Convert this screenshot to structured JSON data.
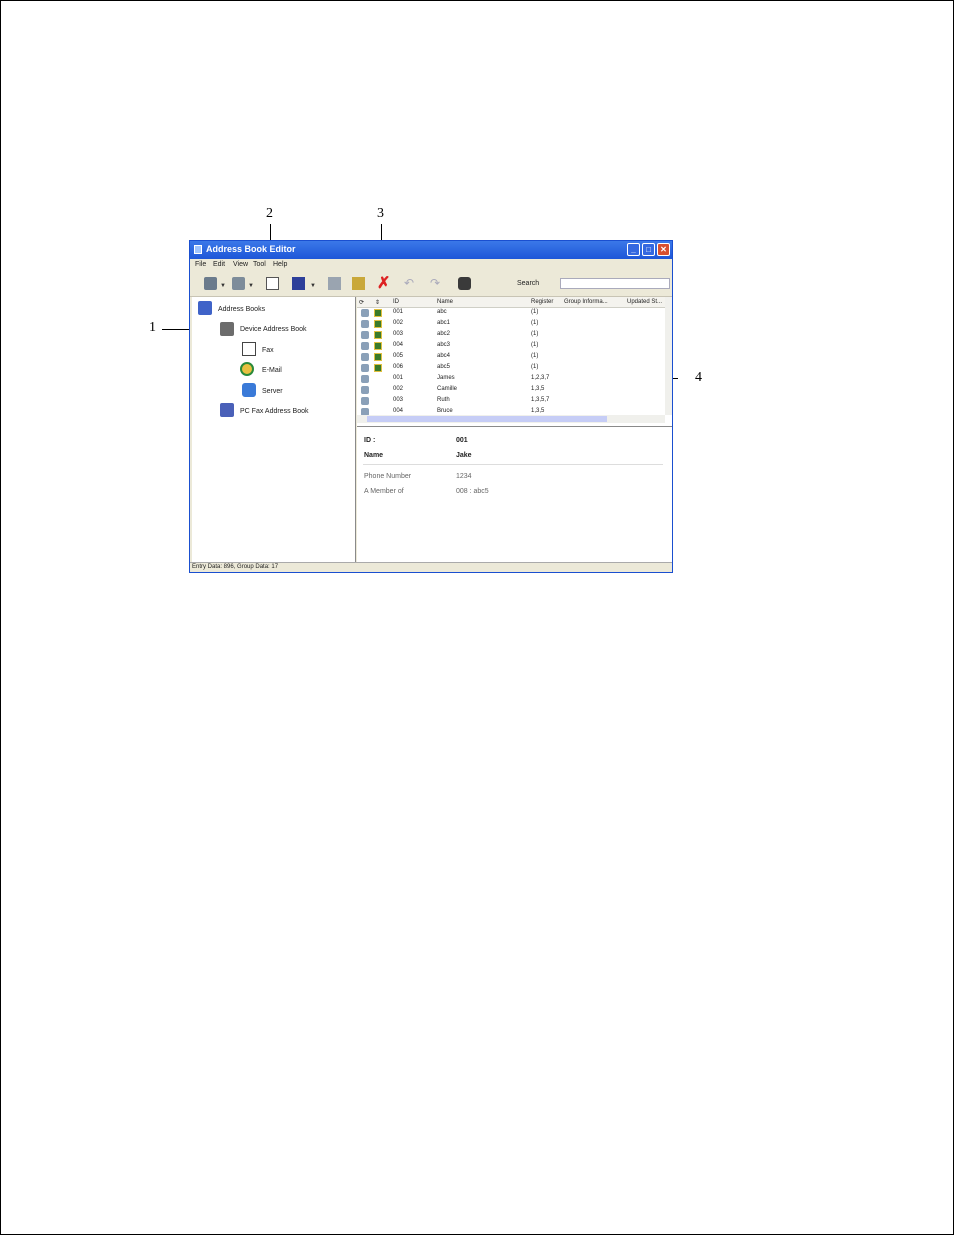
{
  "callouts": [
    "1",
    "2",
    "3",
    "4"
  ],
  "window": {
    "title": "Address Book Editor"
  },
  "menu": [
    "File",
    "Edit",
    "View",
    "Tool",
    "Help"
  ],
  "toolbar": {
    "search_label": "Search",
    "search_value": ""
  },
  "tree": {
    "root": "Address Books",
    "device": "Device Address Book",
    "fax": "Fax",
    "email": "E-Mail",
    "server": "Server",
    "pc_fax": "PC Fax Address Book"
  },
  "list": {
    "columns": [
      "ID",
      "Name",
      "Register",
      "Group Informa...",
      "Updated St..."
    ],
    "rows": [
      {
        "id": "001",
        "name": "abc",
        "reg": "(1)"
      },
      {
        "id": "002",
        "name": "abc1",
        "reg": "(1)"
      },
      {
        "id": "003",
        "name": "abc2",
        "reg": "(1)"
      },
      {
        "id": "004",
        "name": "abc3",
        "reg": "(1)"
      },
      {
        "id": "005",
        "name": "abc4",
        "reg": "(1)"
      },
      {
        "id": "006",
        "name": "abc5",
        "reg": "(1)"
      },
      {
        "id": "001",
        "name": "James",
        "reg": "1,2,3,7"
      },
      {
        "id": "002",
        "name": "Camille",
        "reg": "1,3,5"
      },
      {
        "id": "003",
        "name": "Ruth",
        "reg": "1,3,5,7"
      },
      {
        "id": "004",
        "name": "Bruce",
        "reg": "1,3,5"
      }
    ]
  },
  "detail": {
    "id_label": "ID :",
    "id_value": "001",
    "name_label": "Name",
    "name_value": "Jake",
    "phone_label": "Phone Number",
    "phone_value": "1234",
    "member_label": "A Member of",
    "member_value": "008 : abc5"
  },
  "status": "Entry Data: 896, Group Data: 17"
}
